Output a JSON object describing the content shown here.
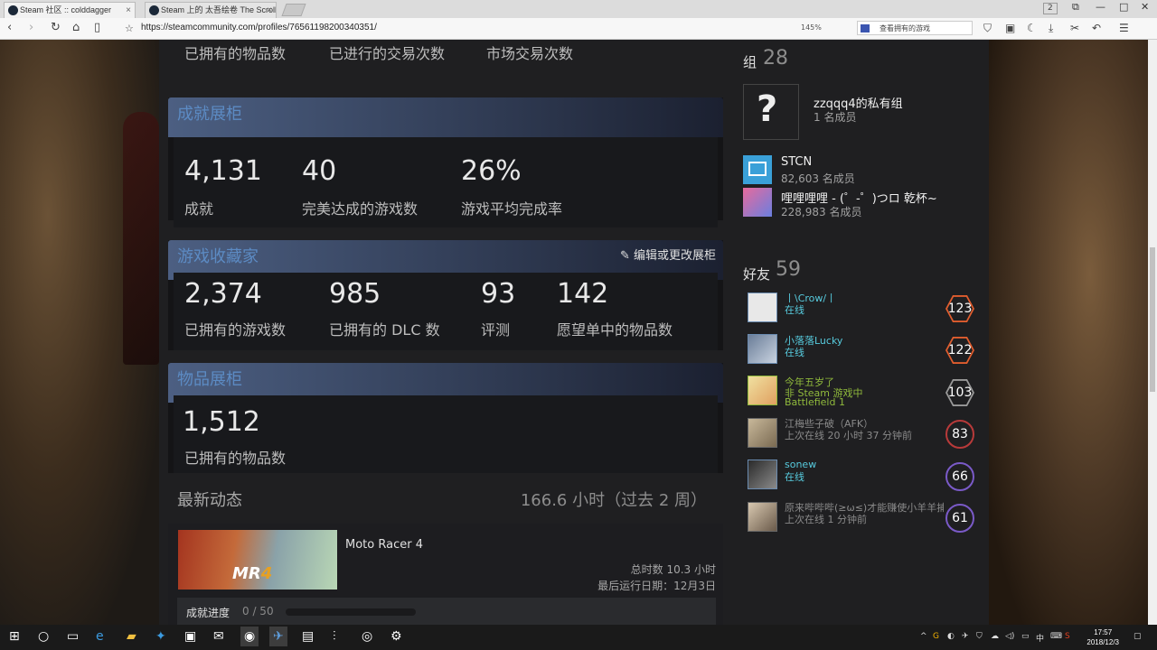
{
  "browser": {
    "tabs": [
      {
        "label": "Steam 社区 :: colddagger",
        "close": "×"
      },
      {
        "label": "Steam 上的 太吾绘卷 The Scroll",
        "close": "×"
      }
    ],
    "window_count": "2",
    "url": "https://steamcommunity.com/profiles/76561198200340351/",
    "zoom": "145%",
    "search_placeholder": "查看拥有的游戏",
    "controls": {
      "minimize": "—",
      "maximize": "□",
      "close": "✕"
    }
  },
  "top_labels": [
    "已拥有的物品数",
    "已进行的交易次数",
    "市场交易次数"
  ],
  "achievement_showcase": {
    "title": "成就展柜",
    "stats": [
      {
        "value": "4,131",
        "label": "成就"
      },
      {
        "value": "40",
        "label": "完美达成的游戏数"
      },
      {
        "value": "26%",
        "label": "游戏平均完成率"
      }
    ]
  },
  "game_collector": {
    "title": "游戏收藏家",
    "edit_label": "编辑或更改展柜",
    "stats": [
      {
        "value": "2,374",
        "label": "已拥有的游戏数"
      },
      {
        "value": "985",
        "label": "已拥有的 DLC 数"
      },
      {
        "value": "93",
        "label": "评测"
      },
      {
        "value": "142",
        "label": "愿望单中的物品数"
      }
    ]
  },
  "item_showcase": {
    "title": "物品展柜",
    "value": "1,512",
    "label": "已拥有的物品数"
  },
  "recent_activity": {
    "title": "最新动态",
    "hours": "166.6 小时（过去 2 周）",
    "game": {
      "name": "Moto Racer 4",
      "logo_main": "MR",
      "logo_num": "4",
      "total": "总时数 10.3 小时",
      "last_played": "最后运行日期：12月3日",
      "ach_label": "成就进度",
      "ach_count": "0 / 50",
      "ach_progress": 0
    }
  },
  "groups": {
    "title": "组",
    "count": "28",
    "items": [
      {
        "name": "zzqqq4的私有组",
        "members": "1 名成员",
        "icon": "question-mark-icon",
        "glyph": "?"
      },
      {
        "name": "STCN",
        "members": "82,603 名成员",
        "icon": "stcn-icon"
      },
      {
        "name": "哩哩哩哩 - (゜-゜)つロ 乾杯~",
        "members": "228,983 名成员",
        "icon": "bilibili-icon"
      }
    ]
  },
  "friends": {
    "title": "好友",
    "count": "59",
    "items": [
      {
        "name": "丨\\Crow/丨",
        "status": "在线",
        "status2": "",
        "level": "123",
        "state": "online",
        "badge": "hex",
        "badge_color": "#e05d2e"
      },
      {
        "name": "小落落Lucky",
        "status": "在线",
        "status2": "",
        "level": "122",
        "state": "online",
        "badge": "hex",
        "badge_color": "#e05d2e"
      },
      {
        "name": "今年五岁了",
        "status": "非 Steam 游戏中",
        "status2": "Battlefield 1",
        "level": "103",
        "state": "ingame",
        "badge": "hex",
        "badge_color": "#9a9a9a"
      },
      {
        "name": "江梅些子破（AFK）",
        "status": "上次在线 20 小时 37 分钟前",
        "status2": "",
        "level": "83",
        "state": "offline",
        "badge": "circle",
        "badge_color": "#b83a3a"
      },
      {
        "name": "sonew",
        "status": "在线",
        "status2": "",
        "level": "66",
        "state": "online",
        "badge": "circle",
        "badge_color": "#7a5ac8"
      },
      {
        "name": "原来哔哔哔(≥ω≤)才能赚使小羊羊捕...",
        "status": "上次在线 1 分钟前",
        "status2": "",
        "level": "61",
        "state": "offline",
        "badge": "circle",
        "badge_color": "#7a5ac8"
      }
    ]
  },
  "colors": {
    "online": "#57cbde",
    "ingame": "#90ba3c",
    "offline": "#8a8a8a",
    "title_blue": "#5c8bc4"
  },
  "taskbar": {
    "time": "17:57",
    "date": "2018/12/3",
    "lang": "中",
    "icons": [
      "windows-icon",
      "cortana-icon",
      "task-view-icon",
      "edge-icon",
      "file-explorer-icon",
      "store-icon",
      "bag-icon",
      "mail-icon",
      "browser-icon",
      "steam-folder-icon",
      "app-icon",
      "app2-icon",
      "steam-icon",
      "steam-taskbar-icon"
    ]
  }
}
